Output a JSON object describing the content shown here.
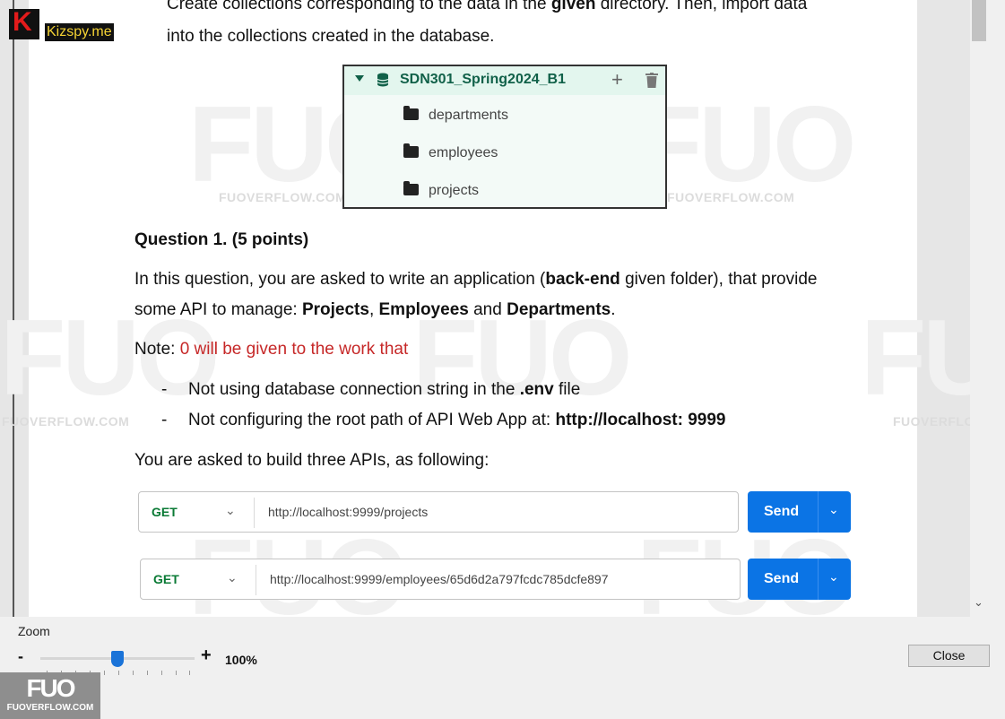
{
  "document": {
    "intro_line1_pre": "Create collections corresponding to the data in the ",
    "intro_line1_bold": "given",
    "intro_line1_post": " directory. Then, import data",
    "intro_line2": "into the collections created in the database.",
    "db_tree": {
      "database": "SDN301_Spring2024_B1",
      "collections": [
        "departments",
        "employees",
        "projects"
      ]
    },
    "question_title": "Question 1. (5 points)",
    "para1_a": "In this question, you are asked to write an application (",
    "para1_b": "back-end",
    "para1_c": " given folder), that provide",
    "para2_a": "some API to manage: ",
    "para2_b": "Projects",
    "para2_c": ", ",
    "para2_d": "Employees",
    "para2_e": " and ",
    "para2_f": "Departments",
    "para2_g": ".",
    "note_label": "Note: ",
    "note_red": "0 will be given to the work that",
    "bullets": [
      {
        "pre": "Not using database connection string in the ",
        "bold": ".env",
        "post": " file"
      },
      {
        "pre": "Not configuring the root path of API Web App at: ",
        "bold": "http://localhost: 9999",
        "post": ""
      }
    ],
    "bullet_dash": "-",
    "apis_intro": "You are asked to build three APIs, as following:",
    "requests": [
      {
        "method": "GET",
        "url": "http://localhost:9999/projects",
        "send": "Send"
      },
      {
        "method": "GET",
        "url": "http://localhost:9999/employees/65d6d2a797fcdc785dcfe897",
        "send": "Send"
      }
    ]
  },
  "watermarks": {
    "site": "FUOVERFLOW.COM",
    "logo": "FUO"
  },
  "brand": {
    "kizspy_letter": "K",
    "kizspy": "Kizspy.me",
    "fuo_logo": "FUO",
    "fuo_site": "FUOVERFLOW.COM"
  },
  "controls": {
    "zoom_label": "Zoom",
    "zoom_minus": "-",
    "zoom_plus": "+",
    "zoom_value": "100%",
    "zoom_level": 1.0,
    "close_label": "Close"
  },
  "colors": {
    "send_button": "#0b74e5",
    "method_get": "#0a7a35",
    "note_red": "#c62828",
    "db_green": "#116149"
  }
}
